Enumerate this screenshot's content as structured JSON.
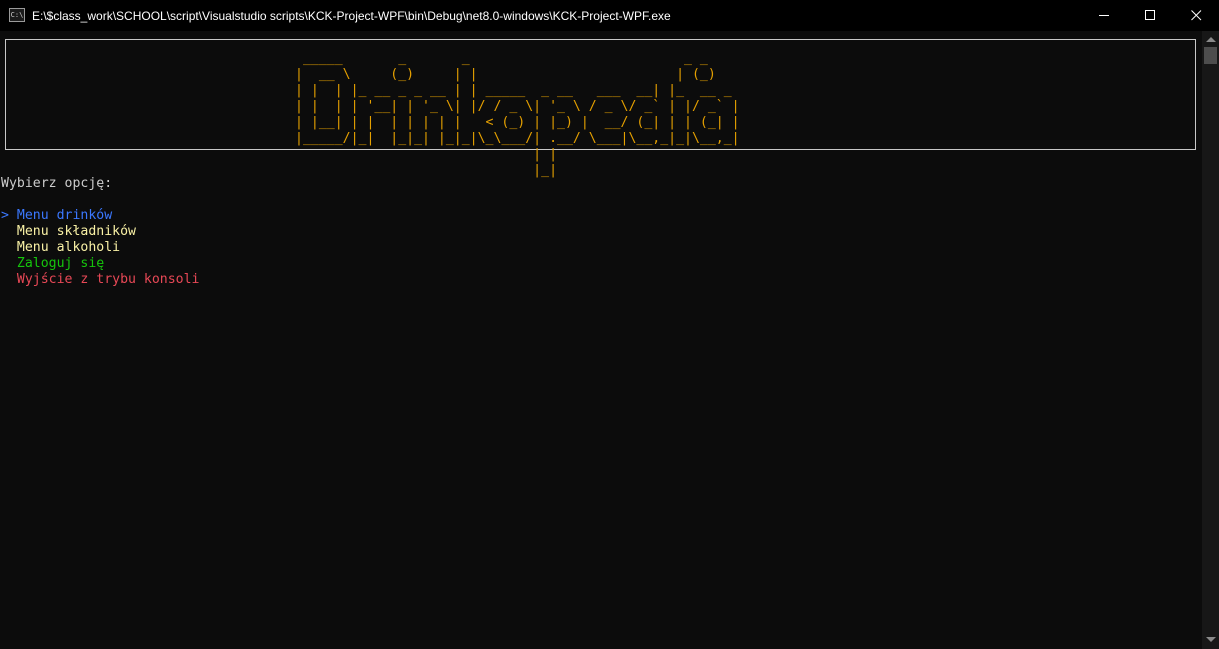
{
  "window": {
    "title": "E:\\$class_work\\SCHOOL\\script\\Visualstudio scripts\\KCK-Project-WPF\\bin\\Debug\\net8.0-windows\\KCK-Project-WPF.exe",
    "icon": "console-app-icon",
    "icon_text": "C:\\",
    "controls": {
      "minimize": "minimize-icon",
      "maximize": "maximize-icon",
      "close": "close-icon"
    }
  },
  "banner": {
    "art": " _____       _       _                           _ _       \n|  __ \\     (_)     | |                         | (_)      \n| |  | |_ __ _ _ __ | | _____  _ __   ___  __| |_  __ _ \n| |  | | '__| | '_ \\| |/ / _ \\| '_ \\ / _ \\/ _` | |/ _` |\n| |__| | |  | | | | |   < (_) | |_) |  __/ (_| | | (_| |\n|_____/|_|  |_|_| |_|_|\\_\\___/| .__/ \\___|\\__,_|_|\\__,_|\n                              | |                        \n                              |_|                        ",
    "text": "Drinkopedia",
    "color": "#e5a000"
  },
  "prompt": "Wybierz opcję:",
  "menu": {
    "cursor": ">",
    "items": [
      {
        "label": "Menu drinków",
        "color": "#3b78ff"
      },
      {
        "label": "Menu składników",
        "color": "#f9f1a5"
      },
      {
        "label": "Menu alkoholi",
        "color": "#f9f1a5"
      },
      {
        "label": "Zaloguj się",
        "color": "#16c60c"
      },
      {
        "label": "Wyjście z trybu konsoli",
        "color": "#e74856"
      }
    ]
  },
  "colors": {
    "background": "#0c0c0c",
    "titlebar": "#000000",
    "text": "#cccccc"
  }
}
